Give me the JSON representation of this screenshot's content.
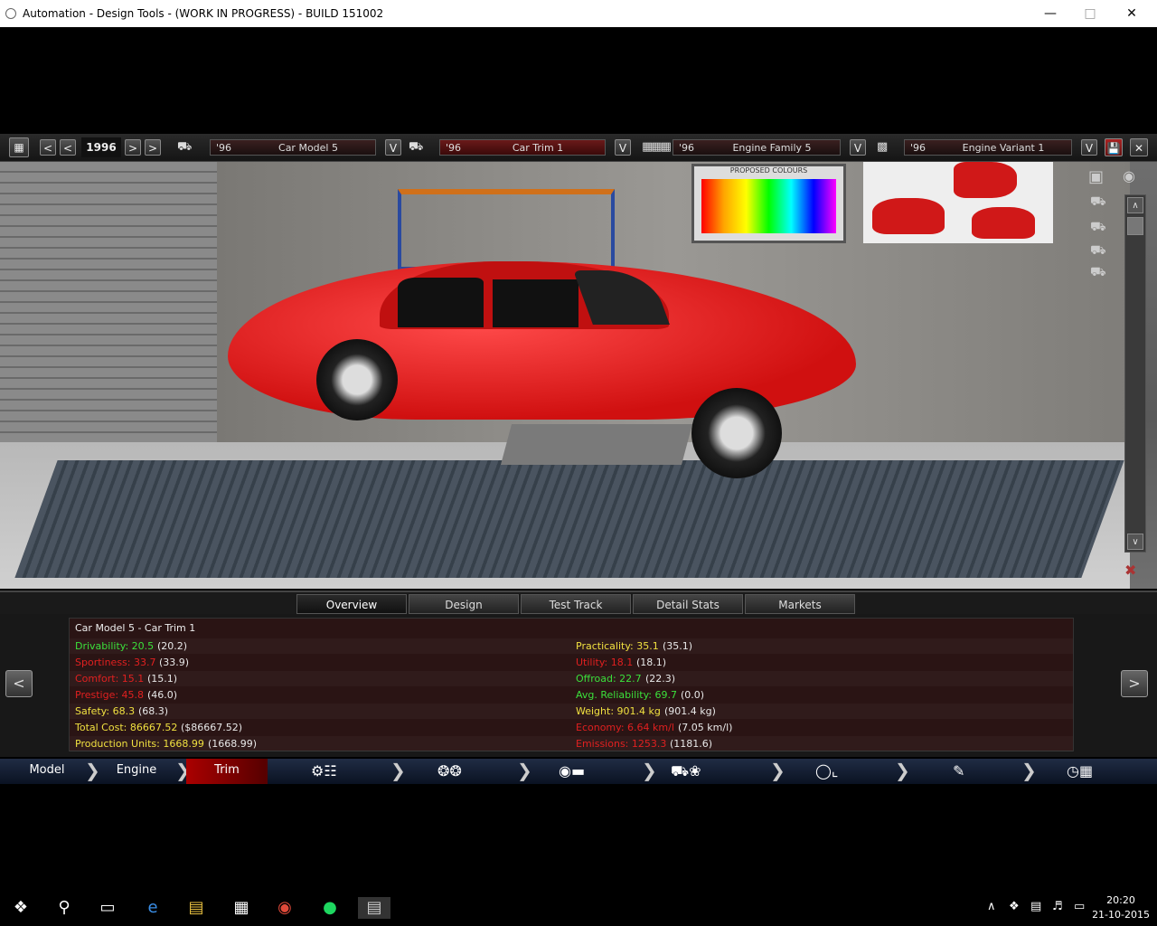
{
  "window": {
    "title": "Automation - Design Tools - (WORK IN PROGRESS) - BUILD 151002"
  },
  "toolbar": {
    "year": "1996",
    "prev_symbol": "<",
    "next_symbol": ">",
    "dropdown_symbol": "V",
    "save_symbol": "💾",
    "close_symbol": "✕",
    "model": {
      "year": "'96",
      "name": "Car Model 5"
    },
    "trim": {
      "year": "'96",
      "name": "Car Trim 1"
    },
    "engine_family": {
      "year": "'96",
      "name": "Engine Family 5"
    },
    "engine_variant": {
      "year": "'96",
      "name": "Engine Variant 1"
    }
  },
  "viewport": {
    "poster_title": "PROPOSED COLOURS"
  },
  "tabs": [
    {
      "label": "Overview",
      "active": true
    },
    {
      "label": "Design"
    },
    {
      "label": "Test Track"
    },
    {
      "label": "Detail Stats"
    },
    {
      "label": "Markets"
    }
  ],
  "stats": {
    "title": "Car Model 5 - Car Trim 1",
    "left": [
      {
        "label": "Drivability: 20.5",
        "value": "(20.2)",
        "color": "g"
      },
      {
        "label": "Sportiness: 33.7",
        "value": "(33.9)",
        "color": "r"
      },
      {
        "label": "Comfort: 15.1",
        "value": "(15.1)",
        "color": "r"
      },
      {
        "label": "Prestige: 45.8",
        "value": "(46.0)",
        "color": "r"
      },
      {
        "label": "Safety: 68.3",
        "value": "(68.3)",
        "color": "y"
      },
      {
        "label": "Total Cost: 86667.52",
        "value": "($86667.52)",
        "color": "y"
      },
      {
        "label": "Production Units: 1668.99",
        "value": "(1668.99)",
        "color": "y"
      }
    ],
    "right": [
      {
        "label": "Practicality: 35.1",
        "value": "(35.1)",
        "color": "y"
      },
      {
        "label": "Utility: 18.1",
        "value": "(18.1)",
        "color": "r"
      },
      {
        "label": "Offroad: 22.7",
        "value": "(22.3)",
        "color": "g"
      },
      {
        "label": "Avg. Reliability: 69.7",
        "value": "(0.0)",
        "color": "g"
      },
      {
        "label": "Weight: 901.4 kg",
        "value": "(901.4 kg)",
        "color": "y"
      },
      {
        "label": "Economy: 6.64 km/l",
        "value": "(7.05 km/l)",
        "color": "r"
      },
      {
        "label": "Emissions: 1253.3",
        "value": "(1181.6)",
        "color": "r"
      }
    ]
  },
  "side_nav": {
    "prev": "<",
    "next": ">"
  },
  "nav": {
    "model": "Model",
    "engine": "Engine",
    "trim": "Trim"
  },
  "taskbar": {
    "time": "20:20",
    "date": "21-10-2015"
  }
}
